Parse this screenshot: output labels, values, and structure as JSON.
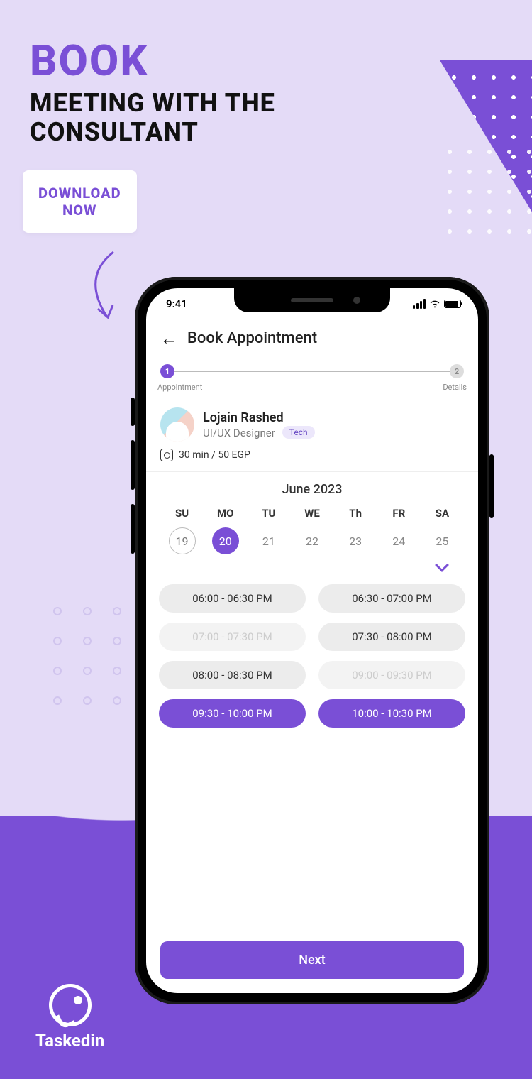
{
  "promo": {
    "headline_top": "BOOK",
    "headline_line1": "MEETING WITH THE",
    "headline_line2": "CONSULTANT",
    "download_line1": "DOWNLOAD",
    "download_line2": "NOW",
    "brand_name": "Taskedin"
  },
  "status": {
    "time": "9:41"
  },
  "screen": {
    "title": "Book Appointment",
    "stepper": {
      "step1_num": "1",
      "step1_label": "Appointment",
      "step2_num": "2",
      "step2_label": "Details"
    },
    "consultant": {
      "name": "Lojain Rashed",
      "role": "UI/UX Designer",
      "tag": "Tech",
      "price": "30 min / 50 EGP"
    },
    "calendar": {
      "month": "June 2023",
      "day_labels": [
        "SU",
        "MO",
        "TU",
        "WE",
        "Th",
        "FR",
        "SA"
      ],
      "dates": [
        {
          "num": "19",
          "state": "today"
        },
        {
          "num": "20",
          "state": "selected"
        },
        {
          "num": "21",
          "state": ""
        },
        {
          "num": "22",
          "state": ""
        },
        {
          "num": "23",
          "state": ""
        },
        {
          "num": "24",
          "state": ""
        },
        {
          "num": "25",
          "state": ""
        }
      ]
    },
    "slots": [
      {
        "label": "06:00 - 06:30 PM",
        "state": "normal"
      },
      {
        "label": "06:30 - 07:00 PM",
        "state": "normal"
      },
      {
        "label": "07:00 - 07:30 PM",
        "state": "disabled"
      },
      {
        "label": "07:30 - 08:00 PM",
        "state": "normal"
      },
      {
        "label": "08:00 - 08:30 PM",
        "state": "normal"
      },
      {
        "label": "09:00 - 09:30 PM",
        "state": "disabled"
      },
      {
        "label": "09:30 - 10:00 PM",
        "state": "selected"
      },
      {
        "label": "10:00 - 10:30 PM",
        "state": "selected"
      }
    ],
    "next_label": "Next"
  }
}
